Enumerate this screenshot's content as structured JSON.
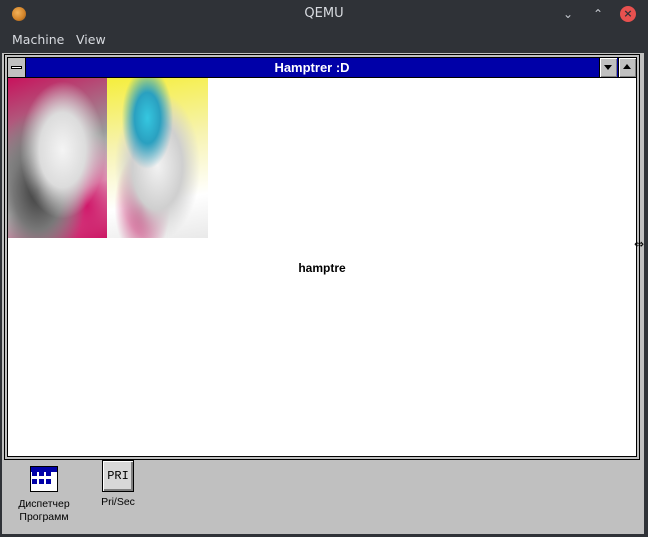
{
  "host": {
    "title": "QEMU",
    "menu": [
      "Machine",
      "View"
    ],
    "controls": {
      "minimize": "⌄",
      "maximize": "⌃",
      "close": "×"
    }
  },
  "guest": {
    "window": {
      "title": "Hamptrer :D"
    },
    "content": {
      "caption": "hamptre"
    },
    "icons": [
      {
        "label_line1": "Диспетчер",
        "label_line2": "Программ"
      },
      {
        "glyph": "PRI",
        "label_line1": "Pri/Sec"
      }
    ]
  }
}
